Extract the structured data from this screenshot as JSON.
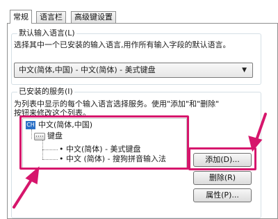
{
  "tabs": [
    {
      "label": "常规",
      "active": true
    },
    {
      "label": "语言栏",
      "active": false
    },
    {
      "label": "高级键设置",
      "active": false
    }
  ],
  "default_language": {
    "title": "默认输入语言(L)",
    "description": "选择其中一个已安装的输入语言,用作所有输入字段的默认语言。",
    "selected": "中文(简体,中国) - 中文(简体) - 美式键盘",
    "arrow_icon": "chevron-down-icon"
  },
  "installed_services": {
    "title": "已安装的服务(I)",
    "description_line1": "为列表中显示的每个输入语言选择服务。使用\"添加\"和\"删除\"",
    "description_line2": "按钮来修改这个列表。",
    "tree": {
      "language_badge": "CH",
      "language": "中文(简体,中国)",
      "category": "键盘",
      "items": [
        "中文(简体) - 美式键盘",
        "中文 (简体) - 搜狗拼音输入法"
      ]
    }
  },
  "buttons": {
    "add": "添加(D)...",
    "remove": "删除(R)",
    "properties": "属性(P)..."
  },
  "colors": {
    "annotation": "#d6166c",
    "lang_badge": "#2c71c6"
  }
}
